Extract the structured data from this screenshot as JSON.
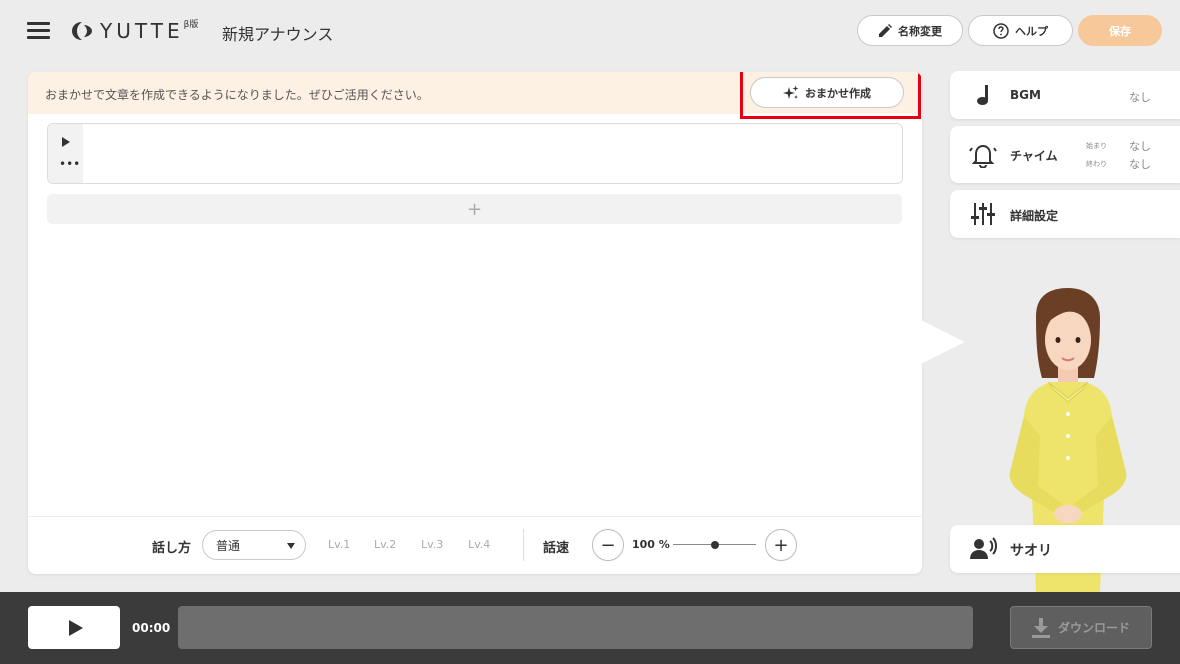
{
  "header": {
    "logo_text": "YUTTE",
    "logo_beta": "β版",
    "title": "新規アナウンス",
    "rename_label": "名称変更",
    "help_label": "ヘルプ",
    "save_label": "保存"
  },
  "notice": {
    "text": "おまかせで文章を作成できるようになりました。ぜひご活用ください。",
    "omakase_label": "おまかせ作成"
  },
  "editor": {
    "add_symbol": "+",
    "more_symbol": "•••"
  },
  "controls": {
    "speech_style_label": "話し方",
    "speech_style_value": "普通",
    "levels": [
      "Lv.1",
      "Lv.2",
      "Lv.3",
      "Lv.4"
    ],
    "speed_label": "話速",
    "speed_value": "100 %",
    "speed_fraction": 0.5,
    "minus": "−",
    "plus": "+"
  },
  "side": {
    "bgm_label": "BGM",
    "bgm_value": "なし",
    "chime_label": "チャイム",
    "chime_start_label": "始まり",
    "chime_start_value": "なし",
    "chime_end_label": "終わり",
    "chime_end_value": "なし",
    "detail_label": "詳細設定",
    "voice_name": "サオリ"
  },
  "player": {
    "time": "00:00",
    "download_label": "ダウンロード"
  },
  "colors": {
    "accent": "#f7c99a",
    "highlight_outline": "#e60012",
    "notice_bg": "#fdf1e4",
    "player_bg": "#3b3b3b"
  },
  "icons": [
    "hamburger-icon",
    "logo-icon",
    "pencil-icon",
    "help-icon",
    "sparkle-icon",
    "play-icon",
    "more-icon",
    "music-note-icon",
    "bell-icon",
    "sliders-icon",
    "speaker-person-icon",
    "download-icon"
  ]
}
